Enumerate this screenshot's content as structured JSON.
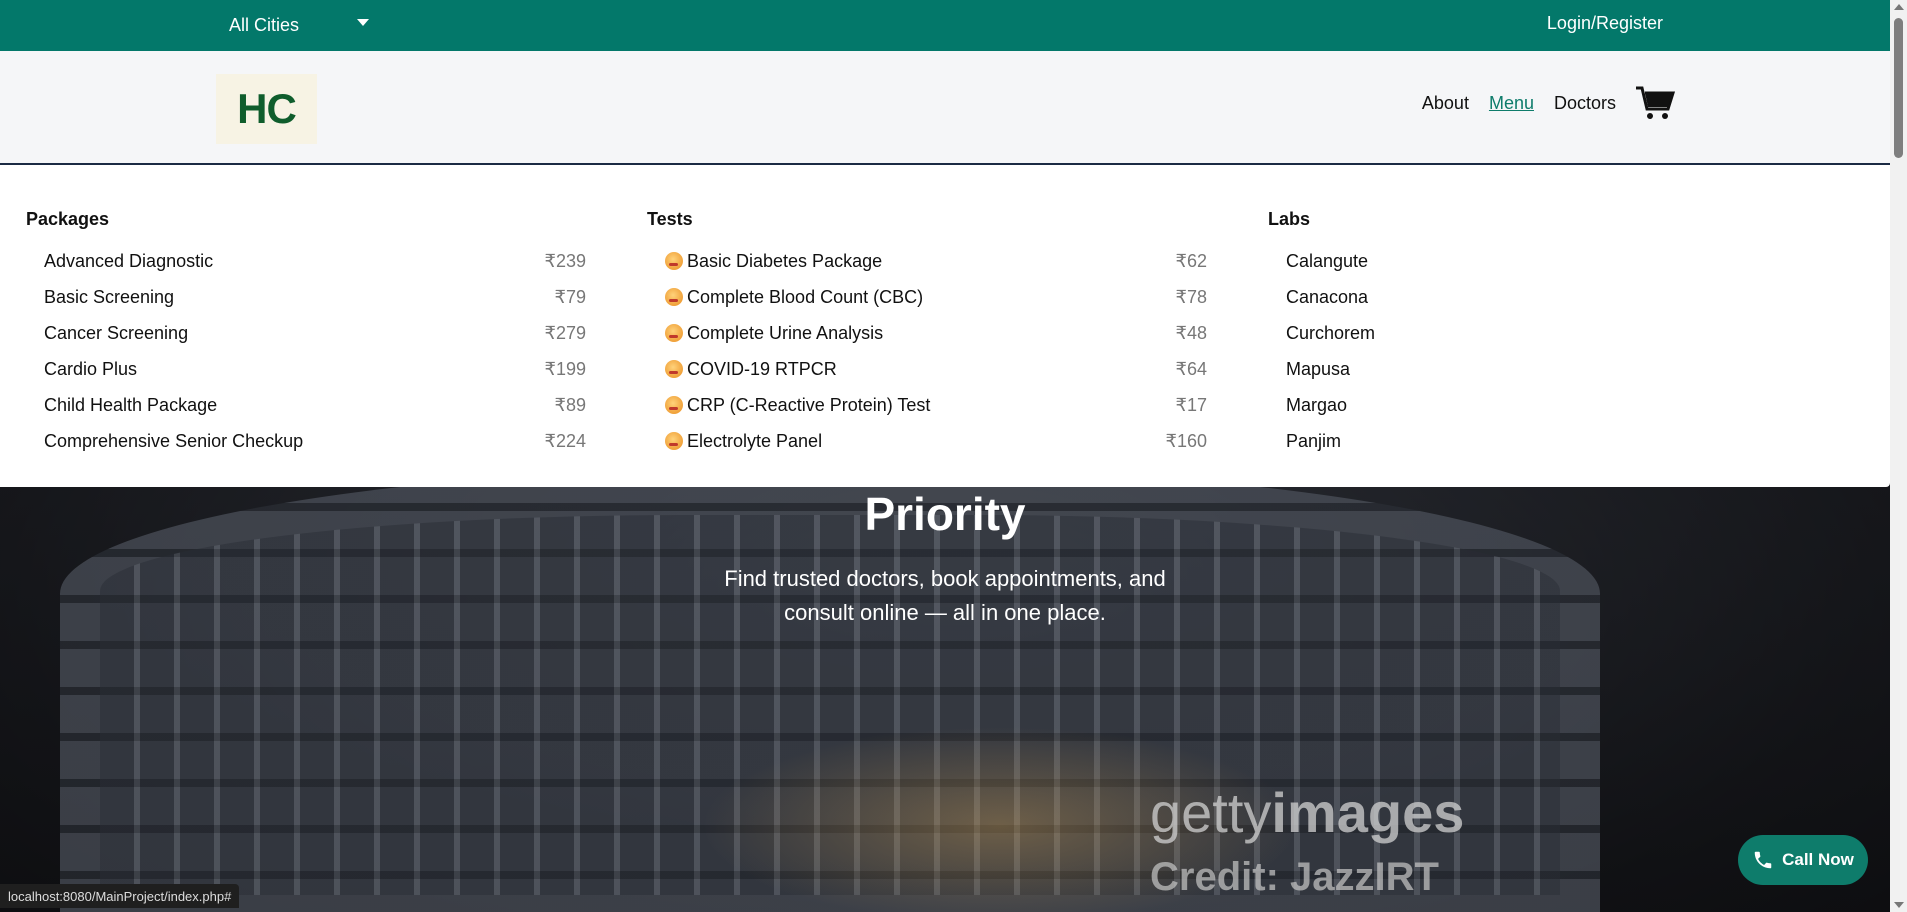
{
  "topbar": {
    "city_select": "All Cities",
    "login": "Login/Register"
  },
  "header": {
    "logo": "HC",
    "nav": {
      "about": "About",
      "menu": "Menu",
      "doctors": "Doctors"
    },
    "cart_icon": "cart-icon"
  },
  "menu": {
    "packages": {
      "title": "Packages",
      "items": [
        {
          "name": "Advanced Diagnostic",
          "price": "₹239"
        },
        {
          "name": "Basic Screening",
          "price": "₹79"
        },
        {
          "name": "Cancer Screening",
          "price": "₹279"
        },
        {
          "name": "Cardio Plus",
          "price": "₹199"
        },
        {
          "name": "Child Health Package",
          "price": "₹89"
        },
        {
          "name": "Comprehensive Senior Checkup",
          "price": "₹224"
        }
      ]
    },
    "tests": {
      "title": "Tests",
      "items": [
        {
          "name": "Basic Diabetes Package",
          "price": "₹62"
        },
        {
          "name": "Complete Blood Count (CBC)",
          "price": "₹78"
        },
        {
          "name": "Complete Urine Analysis",
          "price": "₹48"
        },
        {
          "name": "COVID-19 RTPCR",
          "price": "₹64"
        },
        {
          "name": "CRP (C-Reactive Protein) Test",
          "price": "₹17"
        },
        {
          "name": "Electrolyte Panel",
          "price": "₹160"
        }
      ]
    },
    "labs": {
      "title": "Labs",
      "items": [
        "Calangute",
        "Canacona",
        "Curchorem",
        "Mapusa",
        "Margao",
        "Panjim"
      ]
    }
  },
  "hero": {
    "title": "Priority",
    "subtitle": "Find trusted doctors, book appointments, and consult online — all in one place.",
    "watermark_a": "getty",
    "watermark_b": "images",
    "credit": "Credit: JazzIRT"
  },
  "call_now": "Call Now",
  "status_url": "localhost:8080/MainProject/index.php#",
  "colors": {
    "primary": "#03786a",
    "accent": "#0e7c6b"
  }
}
